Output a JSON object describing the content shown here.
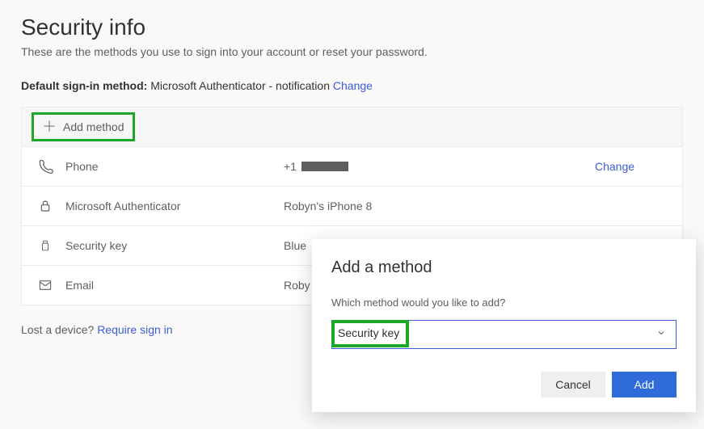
{
  "header": {
    "title": "Security info",
    "subtitle": "These are the methods you use to sign into your account or reset your password."
  },
  "default_method": {
    "label": "Default sign-in method:",
    "value": "Microsoft Authenticator - notification",
    "change_label": "Change"
  },
  "add_method_label": "Add method",
  "methods": [
    {
      "icon": "phone-icon",
      "name": "Phone",
      "detail_prefix": "+1",
      "detail_redacted": true,
      "action": "Change"
    },
    {
      "icon": "lock-icon",
      "name": "Microsoft Authenticator",
      "detail": "Robyn's iPhone 8",
      "action": ""
    },
    {
      "icon": "usb-icon",
      "name": "Security key",
      "detail": "Blue",
      "action": ""
    },
    {
      "icon": "mail-icon",
      "name": "Email",
      "detail": "Roby",
      "action": ""
    }
  ],
  "lost_device": {
    "text": "Lost a device?",
    "link": "Require sign in"
  },
  "dialog": {
    "title": "Add a method",
    "prompt": "Which method would you like to add?",
    "selected": "Security key",
    "cancel": "Cancel",
    "add": "Add"
  }
}
